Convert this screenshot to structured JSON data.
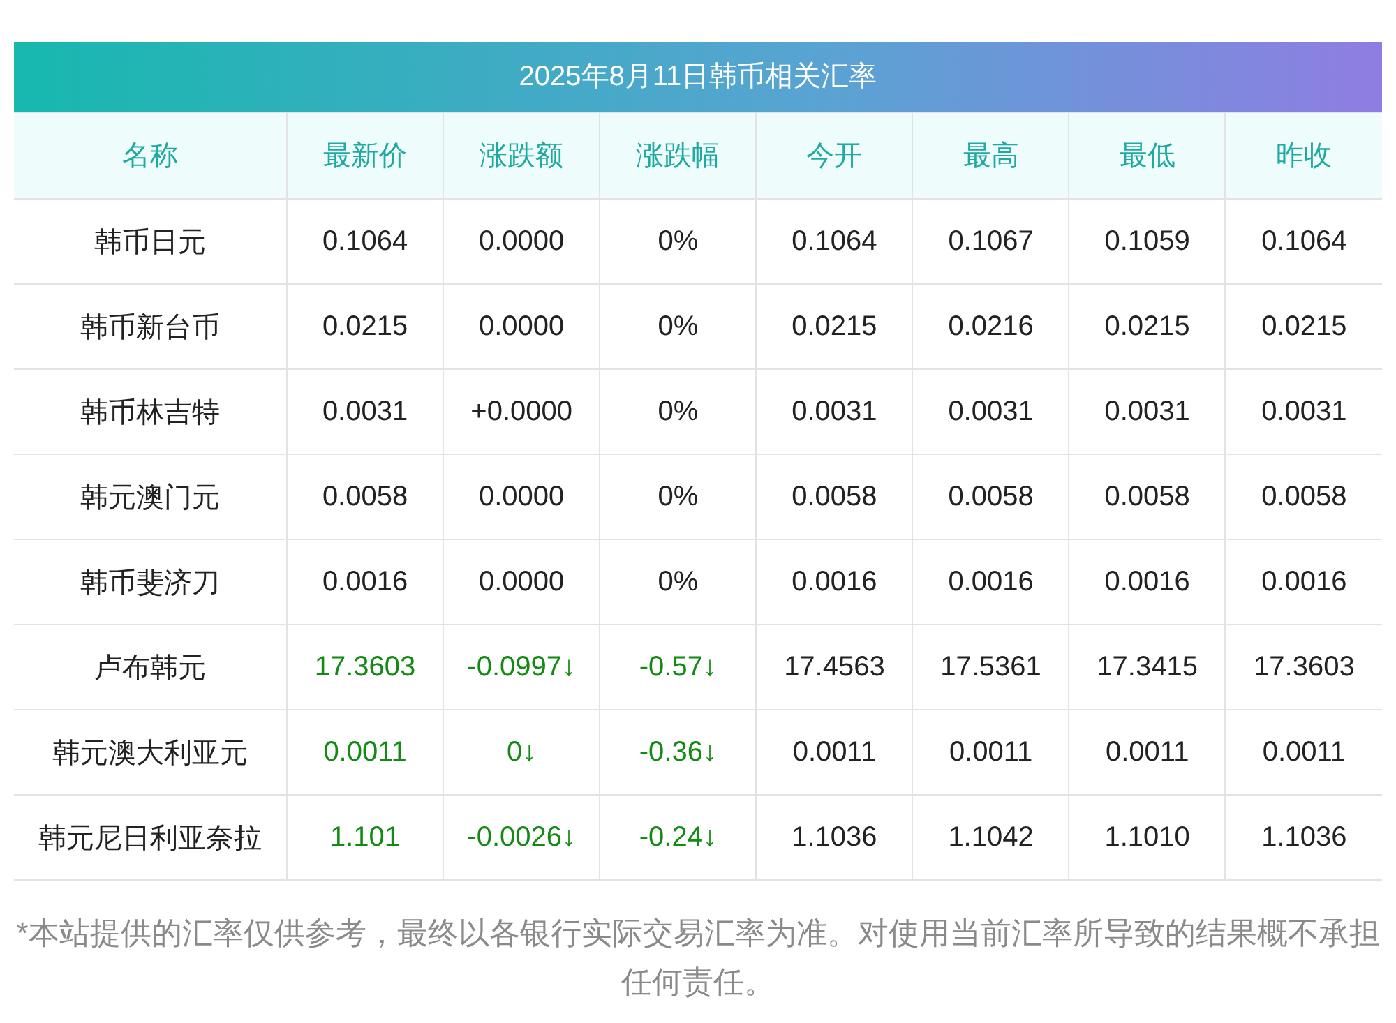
{
  "title": "2025年8月11日韩币相关汇率",
  "columns": [
    "名称",
    "最新价",
    "涨跌额",
    "涨跌幅",
    "今开",
    "最高",
    "最低",
    "昨收"
  ],
  "rows": [
    {
      "color": "#222222",
      "cells": [
        "韩币日元",
        "0.1064",
        "0.0000",
        "0%",
        "0.1064",
        "0.1067",
        "0.1059",
        "0.1064"
      ]
    },
    {
      "color": "#222222",
      "cells": [
        "韩币新台币",
        "0.0215",
        "0.0000",
        "0%",
        "0.0215",
        "0.0216",
        "0.0215",
        "0.0215"
      ]
    },
    {
      "color": "#222222",
      "cells": [
        "韩币林吉特",
        "0.0031",
        "+0.0000",
        "0%",
        "0.0031",
        "0.0031",
        "0.0031",
        "0.0031"
      ]
    },
    {
      "color": "#222222",
      "cells": [
        "韩元澳门元",
        "0.0058",
        "0.0000",
        "0%",
        "0.0058",
        "0.0058",
        "0.0058",
        "0.0058"
      ]
    },
    {
      "color": "#222222",
      "cells": [
        "韩币斐济刀",
        "0.0016",
        "0.0000",
        "0%",
        "0.0016",
        "0.0016",
        "0.0016",
        "0.0016"
      ]
    },
    {
      "color": "#138a13",
      "cells": [
        "卢布韩元",
        "17.3603",
        "-0.0997↓",
        "-0.57↓",
        "17.4563",
        "17.5361",
        "17.3415",
        "17.3603"
      ]
    },
    {
      "color": "#138a13",
      "cells": [
        "韩元澳大利亚元",
        "0.0011",
        "0↓",
        "-0.36↓",
        "0.0011",
        "0.0011",
        "0.0011",
        "0.0011"
      ]
    },
    {
      "color": "#138a13",
      "cells": [
        "韩元尼日利亚奈拉",
        "1.101",
        "-0.0026↓",
        "-0.24↓",
        "1.1036",
        "1.1042",
        "1.1010",
        "1.1036"
      ]
    }
  ],
  "note": "*本站提供的汇率仅供参考，最终以各银行实际交易汇率为准。对使用当前汇率所导致的结果概不承担任何责任。"
}
